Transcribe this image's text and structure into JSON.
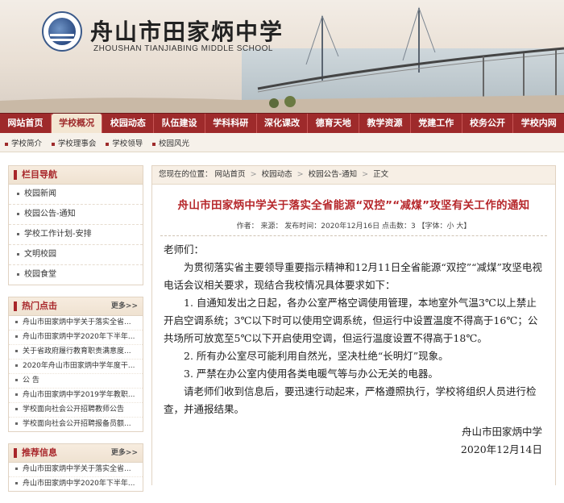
{
  "header": {
    "school_name_cn": "舟山市田家炳中学",
    "school_name_en": "ZHOUSHAN TIANJIABING MIDDLE SCHOOL"
  },
  "nav": {
    "items": [
      "网站首页",
      "学校概况",
      "校园动态",
      "队伍建设",
      "学科科研",
      "深化课改",
      "德育天地",
      "教学资源",
      "党建工作",
      "校务公开",
      "学校内网"
    ],
    "active": 1
  },
  "subnav": {
    "items": [
      "学校简介",
      "学校理事会",
      "学校领导",
      "校园风光"
    ]
  },
  "sidebar": {
    "nav": {
      "title": "栏目导航",
      "items": [
        "校园新闻",
        "校园公告-通知",
        "学校工作计划-安排",
        "文明校园",
        "校园食堂"
      ]
    },
    "hot": {
      "title": "热门点击",
      "more": "更多>>",
      "items": [
        "舟山市田家炳中学关于落实全省...",
        "舟山市田家炳中学2020年下半年...",
        "关于省政府履行教育职责满意度...",
        "2020年舟山市田家炳中学年度干...",
        "公 告",
        "舟山市田家炳中学2019学年教职...",
        "学校面向社会公开招聘教师公告",
        "学校面向社会公开招聘报备员额..."
      ]
    },
    "recommend": {
      "title": "推荐信息",
      "more": "更多>>",
      "items": [
        "舟山市田家炳中学关于落实全省...",
        "舟山市田家炳中学2020年下半年..."
      ]
    }
  },
  "main": {
    "location": {
      "label": "您现在的位置：",
      "crumbs": [
        "网站首页",
        "校园动态",
        "校园公告-通知",
        "正文"
      ],
      "sep": ">"
    },
    "title": "舟山市田家炳中学关于落实全省能源“双控”“减煤”攻坚有关工作的通知",
    "meta": "作者： 来源： 发布时间：2020年12月16日 点击数：3 【字体：小 大】",
    "salutation": "老师们：",
    "paragraphs": [
      "为贯彻落实省主要领导重要指示精神和12月11日全省能源“双控”“减煤”攻坚电视电话会议相关要求，现结合我校情况具体要求如下：",
      "1. 自通知发出之日起，各办公室严格空调使用管理，本地室外气温3℃以上禁止开启空调系统；3℃以下时可以使用空调系统，但运行中设置温度不得高于16℃；公共场所可放宽至5℃以下开启使用空调，但运行温度设置不得高于18℃。",
      "2. 所有办公室尽可能利用自然光，坚决杜绝“长明灯”现象。",
      "3. 严禁在办公室内使用各类电暖气等与办公无关的电器。",
      "请老师们收到信息后，要迅速行动起来，严格遵照执行，学校将组织人员进行检查，并通报结果。"
    ],
    "signature": "舟山市田家炳中学",
    "date": "2020年12月14日"
  }
}
